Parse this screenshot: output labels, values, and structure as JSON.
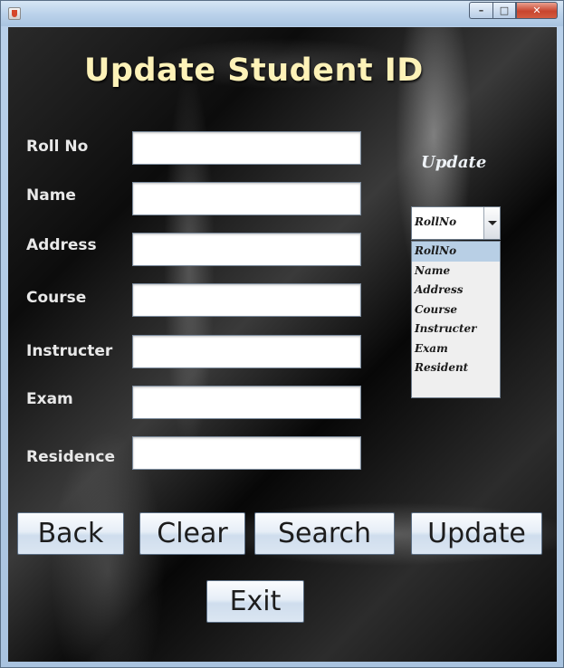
{
  "window": {
    "buttons": {
      "minimize": "–",
      "maximize": "□",
      "close": "✕"
    },
    "icons": {
      "app": "java-app-icon"
    }
  },
  "form": {
    "title": "Update Student ID",
    "fields": [
      {
        "label": "Roll No",
        "value": ""
      },
      {
        "label": "Name",
        "value": ""
      },
      {
        "label": "Address",
        "value": ""
      },
      {
        "label": "Course",
        "value": ""
      },
      {
        "label": "Instructer",
        "value": ""
      },
      {
        "label": "Exam",
        "value": ""
      },
      {
        "label": "Residence",
        "value": ""
      }
    ]
  },
  "update_panel": {
    "caption": "Update",
    "selected": "RollNo",
    "options": [
      "RollNo",
      "Name",
      "Address",
      "Course",
      "Instructer",
      "Exam",
      "Resident"
    ]
  },
  "buttons": {
    "back": "Back",
    "clear": "Clear",
    "search": "Search",
    "update": "Update",
    "exit": "Exit"
  },
  "colors": {
    "title": "#fdf2b8",
    "label": "#e8e8e8",
    "background": "#111111",
    "selected_option": "#b8cfe5"
  }
}
